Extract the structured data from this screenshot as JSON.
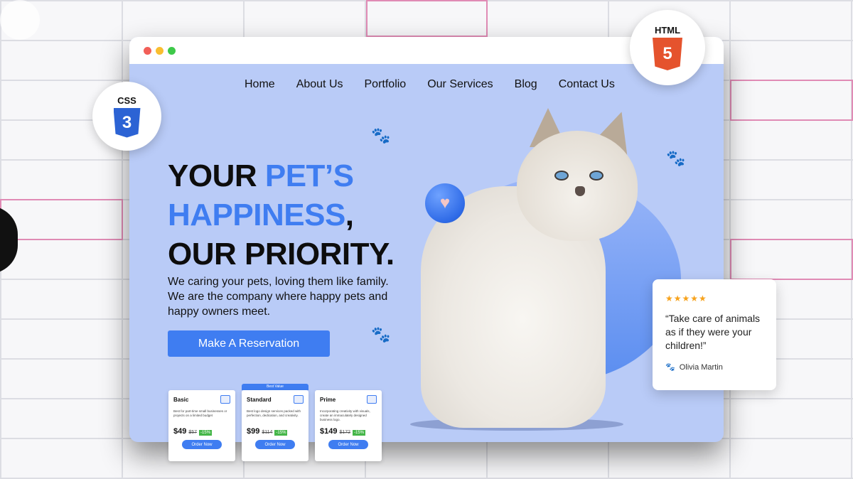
{
  "nav": {
    "items": [
      "Home",
      "About Us",
      "Portfolio",
      "Our Services",
      "Blog",
      "Contact Us"
    ]
  },
  "hero": {
    "title_line1_dark": "YOUR ",
    "title_line1_accent": "PET’S",
    "title_line2_accent": "HAPPINESS",
    "title_line2_dark": ",",
    "title_line3": "OUR PRIORITY.",
    "description": "We caring your pets, loving them like family. We are the company where happy pets and happy owners meet.",
    "cta_label": "Make A Reservation"
  },
  "pricing": {
    "best_value_label": "Best Value",
    "plans": [
      {
        "name": "Basic",
        "description": "Best for part-time small businesses or projects on a limited budget",
        "price": "$49",
        "old_price": "$57",
        "discount": "-15%",
        "button": "Order Now"
      },
      {
        "name": "Standard",
        "description": "Best logo design services packed with perfection, dedication, and creativity.",
        "price": "$99",
        "old_price": "$114",
        "discount": "-15%",
        "button": "Order Now"
      },
      {
        "name": "Prime",
        "description": "Incorporating creativity with visuals, create an immaculately designed business logo.",
        "price": "$149",
        "old_price": "$172",
        "discount": "-15%",
        "button": "Order Now"
      }
    ]
  },
  "badges": {
    "html_label": "HTML",
    "html_number": "5",
    "css_label": "CSS",
    "css_number": "3"
  },
  "testimonial": {
    "stars": "★★★★★",
    "quote": "“Take care of animals as if they were your children!”",
    "author": "Olivia Martin"
  },
  "colors": {
    "accent": "#3f7df1",
    "page_bg": "#b9cbf7",
    "html_orange": "#e5532d",
    "css_blue": "#2c63d4",
    "star_gold": "#f7a21b"
  },
  "icons": [
    "paw-icon",
    "heart-icon",
    "plan-monitor-icon",
    "html5-icon",
    "css3-icon"
  ]
}
